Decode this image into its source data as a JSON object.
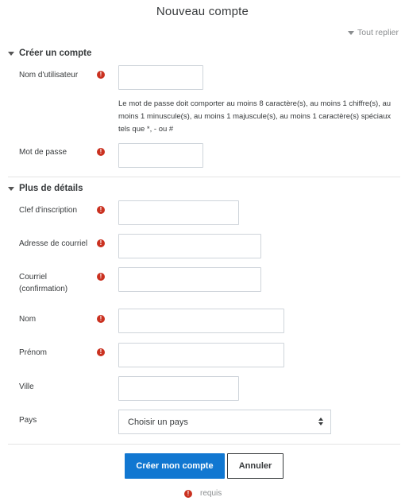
{
  "page": {
    "title": "Nouveau compte",
    "collapse_all": "Tout replier",
    "required_legend": "requis"
  },
  "sections": [
    {
      "label": "Créer un compte"
    },
    {
      "label": "Plus de détails"
    }
  ],
  "account": {
    "username_label": "Nom d'utilisateur",
    "username_value": "",
    "password_help": "Le mot de passe doit comporter au moins 8 caractère(s), au moins 1 chiffre(s), au moins 1 minuscule(s), au moins 1 majuscule(s), au moins 1 caractère(s) spéciaux tels que *, - ou #",
    "password_label": "Mot de passe",
    "password_value": ""
  },
  "details": {
    "enrolment_key_label": "Clef d'inscription",
    "email_label": "Adresse de courriel",
    "email_confirm_label": "Courriel (confirmation)",
    "lastname_label": "Nom",
    "firstname_label": "Prénom",
    "city_label": "Ville",
    "country_label": "Pays",
    "country_selected": "Choisir un pays"
  },
  "buttons": {
    "submit": "Créer mon compte",
    "cancel": "Annuler"
  },
  "icons": {
    "required": "!",
    "required_color": "#ca3120",
    "primary_color": "#1177d1"
  }
}
